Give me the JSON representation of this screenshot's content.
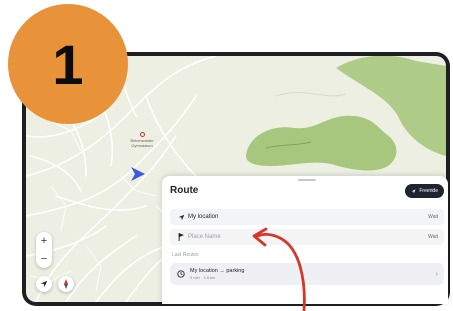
{
  "step": {
    "number": "1",
    "color": "#e8923a"
  },
  "map": {
    "land_color": "#ecefe2",
    "park_color": "#a8c77e",
    "poi": {
      "label_line1": "Birkenwalder",
      "label_line2": "Gymnasium",
      "icon": "marker-icon"
    },
    "controls": {
      "zoom_in": "+",
      "zoom_out": "−"
    }
  },
  "route_panel": {
    "title": "Route",
    "freeride_label": "Freeride",
    "from_field": {
      "value": "My location",
      "end_label": "Wait",
      "icon": "navigation-arrow-icon"
    },
    "to_field": {
      "placeholder": "Place Name",
      "end_label": "Wait",
      "icon": "flag-icon"
    },
    "last_routes_label": "Last Routes",
    "last_route": {
      "title": "My location → parking",
      "subtitle": "3 min · 1.8 km",
      "icon": "clock-icon"
    }
  },
  "accent_colors": {
    "arrow": "#d9362b",
    "button_dark": "#1f2430",
    "location_blue": "#3b5bdb"
  }
}
